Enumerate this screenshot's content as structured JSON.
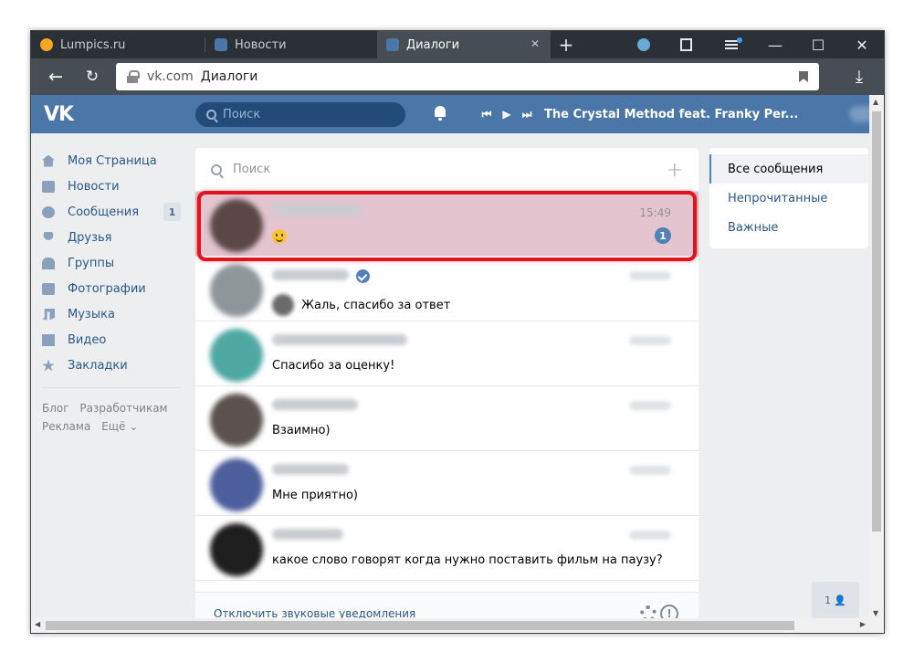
{
  "browser": {
    "tabs": [
      {
        "label": "Lumpics.ru",
        "color": "#f5a623"
      },
      {
        "label": "Новости",
        "color": "#4a76a8"
      },
      {
        "label": "Диалоги",
        "color": "#4a76a8"
      }
    ],
    "close_glyph": "✕",
    "new_tab_glyph": "+",
    "url_host": "vk.com",
    "url_title": "Диалоги",
    "window_controls": {
      "minimize": "—",
      "maximize": "☐",
      "close": "✕"
    }
  },
  "vk": {
    "logo": "VK",
    "search_placeholder": "Поиск",
    "player": {
      "prev": "⏮",
      "play": "▶",
      "next": "⏭",
      "track": "The Crystal Method feat. Franky Per..."
    },
    "menu": [
      {
        "label": "Моя Страница",
        "icon": "home-icon"
      },
      {
        "label": "Новости",
        "icon": "news-icon"
      },
      {
        "label": "Сообщения",
        "icon": "messages-icon",
        "count": "1"
      },
      {
        "label": "Друзья",
        "icon": "friends-icon"
      },
      {
        "label": "Группы",
        "icon": "groups-icon"
      },
      {
        "label": "Фотографии",
        "icon": "photos-icon"
      },
      {
        "label": "Музыка",
        "icon": "music-icon"
      },
      {
        "label": "Видео",
        "icon": "video-icon"
      },
      {
        "label": "Закладки",
        "icon": "bookmarks-icon"
      }
    ],
    "footer_links": [
      "Блог",
      "Разработчикам",
      "Реклама",
      "Ещё ⌄"
    ]
  },
  "messages": {
    "search_placeholder": "Поиск",
    "dialogs": [
      {
        "time": "15:49",
        "text": "",
        "emoji": "smile",
        "unread": "1",
        "avatar_color": "#5a4848"
      },
      {
        "time": "",
        "text": "Жаль, спасибо за ответ",
        "avatar_color": "#8e9699"
      },
      {
        "time": "",
        "text": "Спасибо за оценку!",
        "avatar_color": "#4fa8a3"
      },
      {
        "time": "",
        "text": "Взаимно)",
        "avatar_color": "#5b524f"
      },
      {
        "time": "",
        "text": "Мне приятно)",
        "avatar_color": "#4d5f9c"
      },
      {
        "time": "",
        "text": "какое слово говорят когда нужно поставить фильм на паузу?",
        "avatar_color": "#1e1e1e"
      }
    ],
    "footer_link": "Отключить звуковые уведомления"
  },
  "filters": [
    "Все сообщения",
    "Непрочитанные",
    "Важные"
  ],
  "online_count": "1",
  "colors": {
    "vk_blue": "#4a76a8",
    "highlight_red": "#e0141e",
    "selected_bg": "#e3c4cf"
  }
}
